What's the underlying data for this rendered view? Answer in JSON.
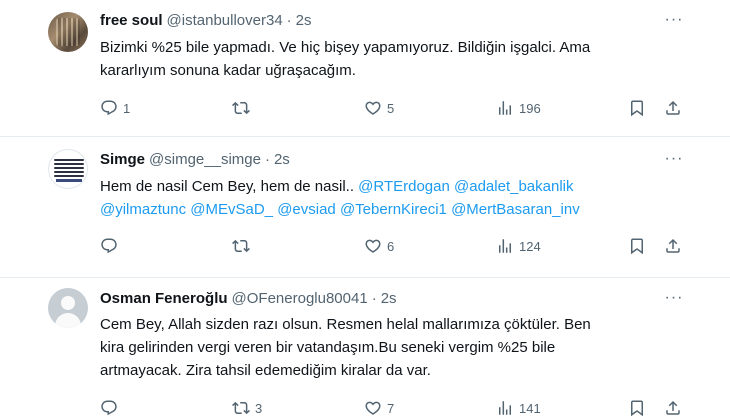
{
  "tweets": [
    {
      "name": "free soul",
      "handle": "@istanbullover34",
      "dot": "·",
      "time": "2s",
      "text_lines": [
        "Bizimki %25 bile yapmadı. Ve hiç bişey yapamıyoruz. Bildiğin işgalci. Ama",
        "kararlıyım sonuna kadar uğraşacağım."
      ],
      "replies": "1",
      "retweets": "",
      "likes": "5",
      "views": "196"
    },
    {
      "name": "Simge",
      "handle": "@simge__simge",
      "dot": "·",
      "time": "2s",
      "text_prefix": "Hem de nasil Cem Bey, hem de nasil.. ",
      "mentions_line1": [
        "@RTErdogan",
        "@adalet_bakanlik"
      ],
      "mentions_line2": [
        "@yilmaztunc",
        "@MEvSaD_",
        "@evsiad",
        "@TebernKireci1",
        "@MertBasaran_inv"
      ],
      "replies": "",
      "retweets": "",
      "likes": "6",
      "views": "124"
    },
    {
      "name": "Osman Feneroğlu",
      "handle": "@OFeneroglu80041",
      "dot": "·",
      "time": "2s",
      "text_lines": [
        "Cem Bey, Allah sizden razı olsun. Resmen helal mallarımıza çöktüler. Ben",
        "kira gelirinden vergi veren bir vatandaşım.Bu seneki vergim %25 bile",
        "artmayacak. Zira tahsil edemediğim kiralar da var."
      ],
      "replies": "",
      "retweets": "3",
      "likes": "7",
      "views": "141"
    }
  ],
  "more_glyph": "···",
  "icons": {
    "reply": "reply-icon",
    "retweet": "retweet-icon",
    "like": "heart-icon",
    "views": "views-icon",
    "bookmark": "bookmark-icon",
    "share": "share-icon"
  }
}
